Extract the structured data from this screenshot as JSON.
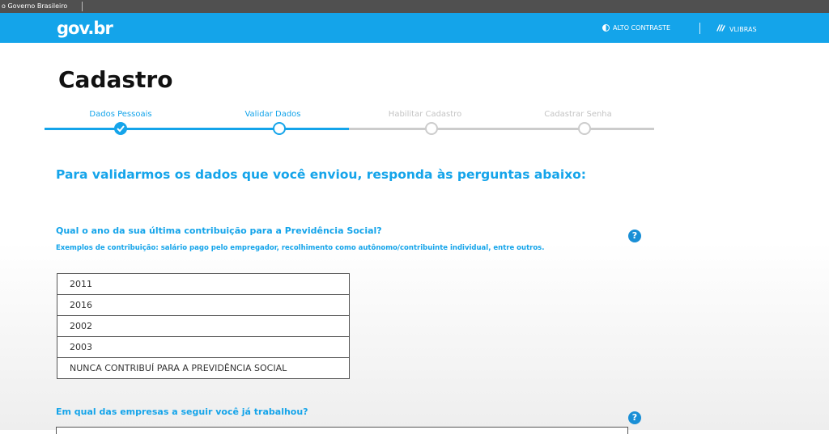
{
  "gov_bar": {
    "text": "o Governo Brasileiro"
  },
  "header": {
    "logo": "gov.br",
    "contrast_label": "ALTO CONTRASTE",
    "contrast_icon": "contrast-icon",
    "libras_label": "VLIBRAS",
    "libras_icon": "hands-icon"
  },
  "page": {
    "title": "Cadastro"
  },
  "stepper": {
    "steps": [
      {
        "label": "Dados Pessoais",
        "state": "done"
      },
      {
        "label": "Validar Dados",
        "state": "current"
      },
      {
        "label": "Habilitar Cadastro",
        "state": "pending"
      },
      {
        "label": "Cadastrar Senha",
        "state": "pending"
      }
    ]
  },
  "intro": "Para validarmos os dados que você enviou, responda às perguntas abaixo:",
  "q1": {
    "question": "Qual o ano da sua última contribuição para a Previdência Social?",
    "hint": "Exemplos de contribuição: salário pago pelo empregador, recolhimento como autônomo/contribuinte individual, entre outros.",
    "help_symbol": "?",
    "options": [
      "2011",
      "2016",
      "2002",
      "2003",
      "NUNCA CONTRIBUÍ PARA A PREVIDÊNCIA SOCIAL"
    ]
  },
  "q2": {
    "question": "Em qual das empresas a seguir você já trabalhou?",
    "help_symbol": "?"
  },
  "colors": {
    "brand_blue": "#14a4ea",
    "help_blue": "#1a8fd6",
    "pending_gray": "#cccccc",
    "gov_bar": "#505050"
  }
}
